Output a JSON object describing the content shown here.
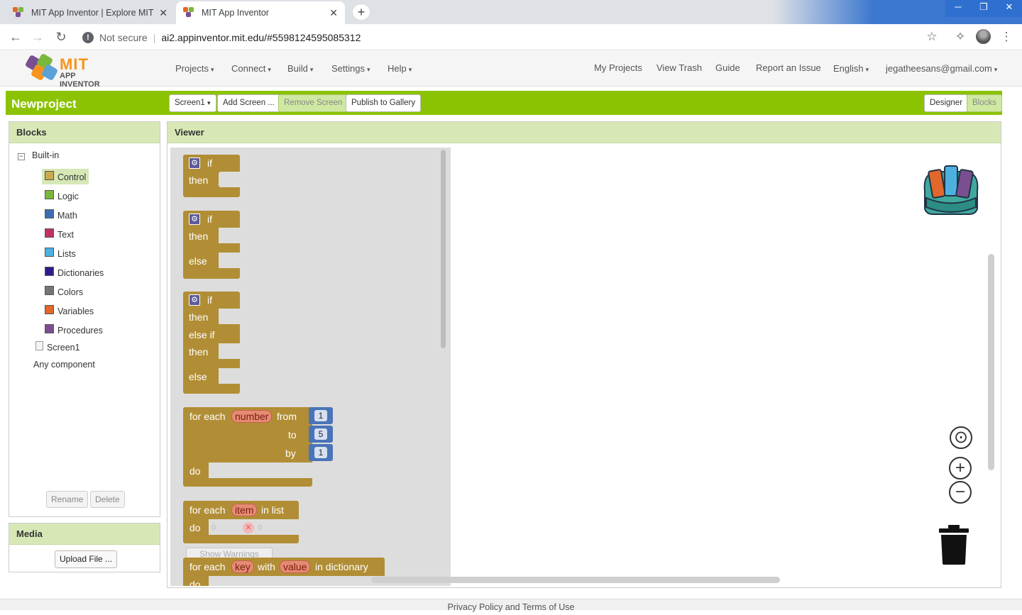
{
  "browser": {
    "tabs": [
      {
        "title": "MIT App Inventor | Explore MIT A",
        "active": false
      },
      {
        "title": "MIT App Inventor",
        "active": true
      }
    ],
    "security_label": "Not secure",
    "url": "ai2.appinventor.mit.edu/#5598124595085312"
  },
  "header": {
    "logo_top": "MIT",
    "logo_bottom": "APP INVENTOR",
    "menus": [
      "Projects",
      "Connect",
      "Build",
      "Settings",
      "Help"
    ],
    "links": [
      "My Projects",
      "View Trash",
      "Guide",
      "Report an Issue"
    ],
    "language": "English",
    "account": "jegatheesans@gmail.com"
  },
  "project": {
    "name": "Newproject",
    "screen_select": "Screen1",
    "add_screen": "Add Screen ...",
    "remove_screen": "Remove Screen",
    "publish": "Publish to Gallery",
    "designer": "Designer",
    "blocks": "Blocks"
  },
  "blocks_panel": {
    "title": "Blocks",
    "root": "Built-in",
    "categories": [
      {
        "label": "Control",
        "color": "#c9a94e",
        "selected": true
      },
      {
        "label": "Logic",
        "color": "#79b83b"
      },
      {
        "label": "Math",
        "color": "#3d6cb5"
      },
      {
        "label": "Text",
        "color": "#c2335f"
      },
      {
        "label": "Lists",
        "color": "#4db1e0"
      },
      {
        "label": "Dictionaries",
        "color": "#2a1d8c"
      },
      {
        "label": "Colors",
        "color": "#757575"
      },
      {
        "label": "Variables",
        "color": "#e2672b"
      },
      {
        "label": "Procedures",
        "color": "#7a4f92"
      }
    ],
    "screen": "Screen1",
    "any_component": "Any component",
    "rename": "Rename",
    "delete": "Delete"
  },
  "media_panel": {
    "title": "Media",
    "upload": "Upload File ..."
  },
  "viewer": {
    "title": "Viewer",
    "blocks": {
      "if": "if",
      "then": "then",
      "else": "else",
      "else_if": "else if",
      "for_each": "for each",
      "from": "from",
      "to": "to",
      "by": "by",
      "do": "do",
      "var_number": "number",
      "num_from": "1",
      "num_to": "5",
      "num_by": "1",
      "var_item": "item",
      "in_list": "in list",
      "var_key": "key",
      "with": "with",
      "var_value": "value",
      "in_dictionary": "in dictionary"
    },
    "warnings_count": "0",
    "errors_count": "0",
    "show_warnings": "Show Warnings"
  },
  "footer": {
    "text": "Privacy Policy and Terms of Use"
  }
}
